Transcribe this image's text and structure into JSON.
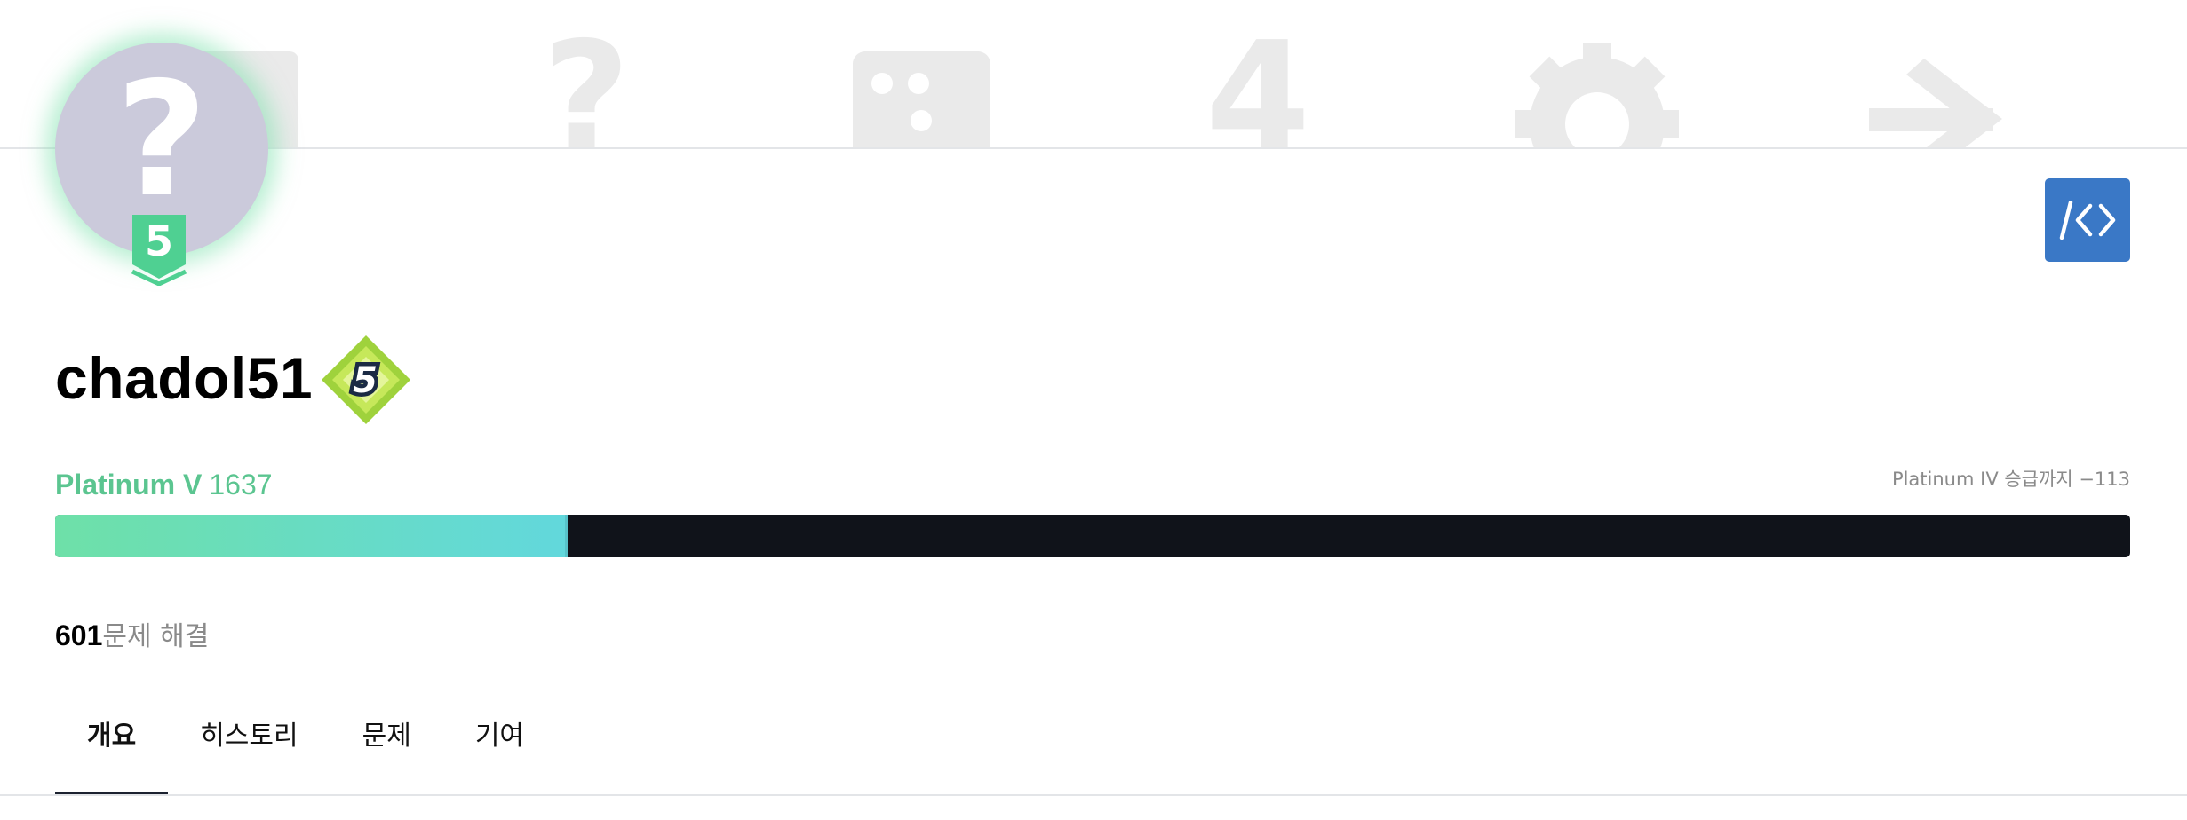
{
  "profile": {
    "username": "chadol51",
    "avatar_glyph": "?",
    "avatar_tier_level": "5",
    "class_level": "5"
  },
  "tier": {
    "name": "Platinum V",
    "rating": "1637",
    "next_tier_text": "Platinum IV 승급까지 −113",
    "progress_fraction": 0.247,
    "color": "#5bc590"
  },
  "stats": {
    "solved_count": "601",
    "solved_label": "문제 해결"
  },
  "tabs": [
    {
      "label": "개요",
      "active": true
    },
    {
      "label": "히스토리",
      "active": false
    },
    {
      "label": "문제",
      "active": false
    },
    {
      "label": "기여",
      "active": false
    }
  ],
  "code_button": {
    "icon": "code-icon",
    "label": "/<>"
  },
  "banner_icons": [
    "square-icon",
    "question-icon",
    "dice-icon",
    "number-4-icon",
    "gear-icon",
    "arrow-right-icon"
  ],
  "colors": {
    "accent": "#3a78c6",
    "avatar_bg": "#cbcadb",
    "progress_track": "#10131a",
    "progress_fill_start": "#6ee0a8",
    "progress_fill_end": "#62d8dc"
  }
}
